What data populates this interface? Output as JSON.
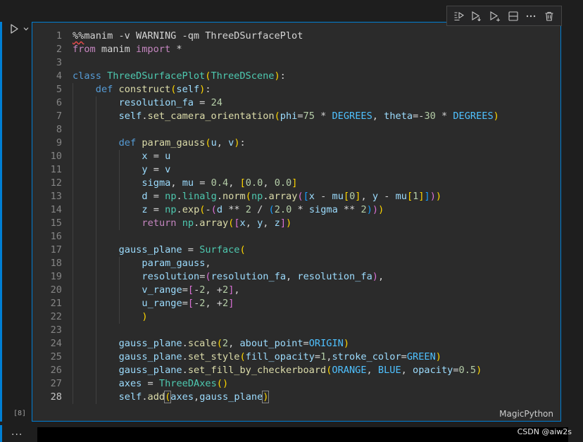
{
  "cell": {
    "execution_count": "[8]",
    "language": "MagicPython",
    "lines": [
      {
        "num": "1",
        "indent": 0,
        "tokens": [
          {
            "t": "%%",
            "c": "op mag"
          },
          {
            "t": "manim -v WARNING -qm ThreeDSurfacePlot",
            "c": "op"
          }
        ]
      },
      {
        "num": "2",
        "indent": 0,
        "tokens": [
          {
            "t": "from",
            "c": "kw2"
          },
          {
            "t": " manim ",
            "c": "op"
          },
          {
            "t": "import",
            "c": "kw2"
          },
          {
            "t": " *",
            "c": "op"
          }
        ]
      },
      {
        "num": "3",
        "indent": 0,
        "tokens": []
      },
      {
        "num": "4",
        "indent": 0,
        "tokens": [
          {
            "t": "class",
            "c": "kw"
          },
          {
            "t": " ",
            "c": "op"
          },
          {
            "t": "ThreeDSurfacePlot",
            "c": "cls"
          },
          {
            "t": "(",
            "c": "br1"
          },
          {
            "t": "ThreeDScene",
            "c": "cls"
          },
          {
            "t": ")",
            "c": "br1"
          },
          {
            "t": ":",
            "c": "op"
          }
        ]
      },
      {
        "num": "5",
        "indent": 1,
        "tokens": [
          {
            "t": "def",
            "c": "kw"
          },
          {
            "t": " ",
            "c": "op"
          },
          {
            "t": "construct",
            "c": "fn"
          },
          {
            "t": "(",
            "c": "br1"
          },
          {
            "t": "self",
            "c": "prm"
          },
          {
            "t": ")",
            "c": "br1"
          },
          {
            "t": ":",
            "c": "op"
          }
        ]
      },
      {
        "num": "6",
        "indent": 2,
        "tokens": [
          {
            "t": "resolution_fa",
            "c": "prm"
          },
          {
            "t": " = ",
            "c": "op"
          },
          {
            "t": "24",
            "c": "num"
          }
        ]
      },
      {
        "num": "7",
        "indent": 2,
        "tokens": [
          {
            "t": "self",
            "c": "prm"
          },
          {
            "t": ".",
            "c": "op"
          },
          {
            "t": "set_camera_orientation",
            "c": "fn"
          },
          {
            "t": "(",
            "c": "br1"
          },
          {
            "t": "phi",
            "c": "prm"
          },
          {
            "t": "=",
            "c": "op"
          },
          {
            "t": "75",
            "c": "num"
          },
          {
            "t": " * ",
            "c": "op"
          },
          {
            "t": "DEGREES",
            "c": "con"
          },
          {
            "t": ", ",
            "c": "op"
          },
          {
            "t": "theta",
            "c": "prm"
          },
          {
            "t": "=-",
            "c": "op"
          },
          {
            "t": "30",
            "c": "num"
          },
          {
            "t": " * ",
            "c": "op"
          },
          {
            "t": "DEGREES",
            "c": "con"
          },
          {
            "t": ")",
            "c": "br1"
          }
        ]
      },
      {
        "num": "8",
        "indent": 2,
        "tokens": []
      },
      {
        "num": "9",
        "indent": 2,
        "tokens": [
          {
            "t": "def",
            "c": "kw"
          },
          {
            "t": " ",
            "c": "op"
          },
          {
            "t": "param_gauss",
            "c": "fn"
          },
          {
            "t": "(",
            "c": "br1"
          },
          {
            "t": "u",
            "c": "prm"
          },
          {
            "t": ", ",
            "c": "op"
          },
          {
            "t": "v",
            "c": "prm"
          },
          {
            "t": ")",
            "c": "br1"
          },
          {
            "t": ":",
            "c": "op"
          }
        ]
      },
      {
        "num": "10",
        "indent": 3,
        "tokens": [
          {
            "t": "x",
            "c": "prm"
          },
          {
            "t": " = ",
            "c": "op"
          },
          {
            "t": "u",
            "c": "prm"
          }
        ]
      },
      {
        "num": "11",
        "indent": 3,
        "tokens": [
          {
            "t": "y",
            "c": "prm"
          },
          {
            "t": " = ",
            "c": "op"
          },
          {
            "t": "v",
            "c": "prm"
          }
        ]
      },
      {
        "num": "12",
        "indent": 3,
        "tokens": [
          {
            "t": "sigma",
            "c": "prm"
          },
          {
            "t": ", ",
            "c": "op"
          },
          {
            "t": "mu",
            "c": "prm"
          },
          {
            "t": " = ",
            "c": "op"
          },
          {
            "t": "0.4",
            "c": "num"
          },
          {
            "t": ", ",
            "c": "op"
          },
          {
            "t": "[",
            "c": "br1"
          },
          {
            "t": "0.0",
            "c": "num"
          },
          {
            "t": ", ",
            "c": "op"
          },
          {
            "t": "0.0",
            "c": "num"
          },
          {
            "t": "]",
            "c": "br1"
          }
        ]
      },
      {
        "num": "13",
        "indent": 3,
        "tokens": [
          {
            "t": "d",
            "c": "prm"
          },
          {
            "t": " = ",
            "c": "op"
          },
          {
            "t": "np",
            "c": "cls"
          },
          {
            "t": ".",
            "c": "op"
          },
          {
            "t": "linalg",
            "c": "cls"
          },
          {
            "t": ".",
            "c": "op"
          },
          {
            "t": "norm",
            "c": "fn"
          },
          {
            "t": "(",
            "c": "br1"
          },
          {
            "t": "np",
            "c": "cls"
          },
          {
            "t": ".",
            "c": "op"
          },
          {
            "t": "array",
            "c": "fn"
          },
          {
            "t": "(",
            "c": "br2"
          },
          {
            "t": "[",
            "c": "br3"
          },
          {
            "t": "x",
            "c": "prm"
          },
          {
            "t": " - ",
            "c": "op"
          },
          {
            "t": "mu",
            "c": "prm"
          },
          {
            "t": "[",
            "c": "br1"
          },
          {
            "t": "0",
            "c": "num"
          },
          {
            "t": "]",
            "c": "br1"
          },
          {
            "t": ", ",
            "c": "op"
          },
          {
            "t": "y",
            "c": "prm"
          },
          {
            "t": " - ",
            "c": "op"
          },
          {
            "t": "mu",
            "c": "prm"
          },
          {
            "t": "[",
            "c": "br1"
          },
          {
            "t": "1",
            "c": "num"
          },
          {
            "t": "]",
            "c": "br1"
          },
          {
            "t": "]",
            "c": "br3"
          },
          {
            "t": ")",
            "c": "br2"
          },
          {
            "t": ")",
            "c": "br1"
          }
        ]
      },
      {
        "num": "14",
        "indent": 3,
        "tokens": [
          {
            "t": "z",
            "c": "prm"
          },
          {
            "t": " = ",
            "c": "op"
          },
          {
            "t": "np",
            "c": "cls"
          },
          {
            "t": ".",
            "c": "op"
          },
          {
            "t": "exp",
            "c": "fn"
          },
          {
            "t": "(",
            "c": "br1"
          },
          {
            "t": "-",
            "c": "op"
          },
          {
            "t": "(",
            "c": "br2"
          },
          {
            "t": "d",
            "c": "prm"
          },
          {
            "t": " ** ",
            "c": "op"
          },
          {
            "t": "2",
            "c": "num"
          },
          {
            "t": " / ",
            "c": "op"
          },
          {
            "t": "(",
            "c": "br3"
          },
          {
            "t": "2.0",
            "c": "num"
          },
          {
            "t": " * ",
            "c": "op"
          },
          {
            "t": "sigma",
            "c": "prm"
          },
          {
            "t": " ** ",
            "c": "op"
          },
          {
            "t": "2",
            "c": "num"
          },
          {
            "t": ")",
            "c": "br3"
          },
          {
            "t": ")",
            "c": "br2"
          },
          {
            "t": ")",
            "c": "br1"
          }
        ]
      },
      {
        "num": "15",
        "indent": 3,
        "tokens": [
          {
            "t": "return",
            "c": "kw2"
          },
          {
            "t": " ",
            "c": "op"
          },
          {
            "t": "np",
            "c": "cls"
          },
          {
            "t": ".",
            "c": "op"
          },
          {
            "t": "array",
            "c": "fn"
          },
          {
            "t": "(",
            "c": "br1"
          },
          {
            "t": "[",
            "c": "br2"
          },
          {
            "t": "x",
            "c": "prm"
          },
          {
            "t": ", ",
            "c": "op"
          },
          {
            "t": "y",
            "c": "prm"
          },
          {
            "t": ", ",
            "c": "op"
          },
          {
            "t": "z",
            "c": "prm"
          },
          {
            "t": "]",
            "c": "br2"
          },
          {
            "t": ")",
            "c": "br1"
          }
        ]
      },
      {
        "num": "16",
        "indent": 2,
        "tokens": []
      },
      {
        "num": "17",
        "indent": 2,
        "tokens": [
          {
            "t": "gauss_plane",
            "c": "prm"
          },
          {
            "t": " = ",
            "c": "op"
          },
          {
            "t": "Surface",
            "c": "cls"
          },
          {
            "t": "(",
            "c": "br1"
          }
        ]
      },
      {
        "num": "18",
        "indent": 3,
        "tokens": [
          {
            "t": "param_gauss",
            "c": "prm"
          },
          {
            "t": ",",
            "c": "op"
          }
        ]
      },
      {
        "num": "19",
        "indent": 3,
        "tokens": [
          {
            "t": "resolution",
            "c": "prm"
          },
          {
            "t": "=",
            "c": "op"
          },
          {
            "t": "(",
            "c": "br2"
          },
          {
            "t": "resolution_fa",
            "c": "prm"
          },
          {
            "t": ", ",
            "c": "op"
          },
          {
            "t": "resolution_fa",
            "c": "prm"
          },
          {
            "t": ")",
            "c": "br2"
          },
          {
            "t": ",",
            "c": "op"
          }
        ]
      },
      {
        "num": "20",
        "indent": 3,
        "tokens": [
          {
            "t": "v_range",
            "c": "prm"
          },
          {
            "t": "=",
            "c": "op"
          },
          {
            "t": "[",
            "c": "br2"
          },
          {
            "t": "-",
            "c": "op"
          },
          {
            "t": "2",
            "c": "num"
          },
          {
            "t": ", +",
            "c": "op"
          },
          {
            "t": "2",
            "c": "num"
          },
          {
            "t": "]",
            "c": "br2"
          },
          {
            "t": ",",
            "c": "op"
          }
        ]
      },
      {
        "num": "21",
        "indent": 3,
        "tokens": [
          {
            "t": "u_range",
            "c": "prm"
          },
          {
            "t": "=",
            "c": "op"
          },
          {
            "t": "[",
            "c": "br2"
          },
          {
            "t": "-",
            "c": "op"
          },
          {
            "t": "2",
            "c": "num"
          },
          {
            "t": ", +",
            "c": "op"
          },
          {
            "t": "2",
            "c": "num"
          },
          {
            "t": "]",
            "c": "br2"
          }
        ]
      },
      {
        "num": "22",
        "indent": 3,
        "tokens": [
          {
            "t": ")",
            "c": "br1"
          }
        ]
      },
      {
        "num": "23",
        "indent": 2,
        "tokens": []
      },
      {
        "num": "24",
        "indent": 2,
        "tokens": [
          {
            "t": "gauss_plane",
            "c": "prm"
          },
          {
            "t": ".",
            "c": "op"
          },
          {
            "t": "scale",
            "c": "fn"
          },
          {
            "t": "(",
            "c": "br1"
          },
          {
            "t": "2",
            "c": "num"
          },
          {
            "t": ", ",
            "c": "op"
          },
          {
            "t": "about_point",
            "c": "prm"
          },
          {
            "t": "=",
            "c": "op"
          },
          {
            "t": "ORIGIN",
            "c": "con"
          },
          {
            "t": ")",
            "c": "br1"
          }
        ]
      },
      {
        "num": "25",
        "indent": 2,
        "tokens": [
          {
            "t": "gauss_plane",
            "c": "prm"
          },
          {
            "t": ".",
            "c": "op"
          },
          {
            "t": "set_style",
            "c": "fn"
          },
          {
            "t": "(",
            "c": "br1"
          },
          {
            "t": "fill_opacity",
            "c": "prm"
          },
          {
            "t": "=",
            "c": "op"
          },
          {
            "t": "1",
            "c": "num"
          },
          {
            "t": ",",
            "c": "op"
          },
          {
            "t": "stroke_color",
            "c": "prm"
          },
          {
            "t": "=",
            "c": "op"
          },
          {
            "t": "GREEN",
            "c": "con"
          },
          {
            "t": ")",
            "c": "br1"
          }
        ]
      },
      {
        "num": "26",
        "indent": 2,
        "tokens": [
          {
            "t": "gauss_plane",
            "c": "prm"
          },
          {
            "t": ".",
            "c": "op"
          },
          {
            "t": "set_fill_by_checkerboard",
            "c": "fn"
          },
          {
            "t": "(",
            "c": "br1"
          },
          {
            "t": "ORANGE",
            "c": "con"
          },
          {
            "t": ", ",
            "c": "op"
          },
          {
            "t": "BLUE",
            "c": "con"
          },
          {
            "t": ", ",
            "c": "op"
          },
          {
            "t": "opacity",
            "c": "prm"
          },
          {
            "t": "=",
            "c": "op"
          },
          {
            "t": "0.5",
            "c": "num"
          },
          {
            "t": ")",
            "c": "br1"
          }
        ]
      },
      {
        "num": "27",
        "indent": 2,
        "tokens": [
          {
            "t": "axes",
            "c": "prm"
          },
          {
            "t": " = ",
            "c": "op"
          },
          {
            "t": "ThreeDAxes",
            "c": "cls"
          },
          {
            "t": "(",
            "c": "br1"
          },
          {
            "t": ")",
            "c": "br1"
          }
        ]
      },
      {
        "num": "28",
        "indent": 2,
        "active": true,
        "tokens": [
          {
            "t": "self",
            "c": "prm"
          },
          {
            "t": ".",
            "c": "op"
          },
          {
            "t": "add",
            "c": "fn"
          },
          {
            "t": "(",
            "c": "br1 bracket-box"
          },
          {
            "t": "axes",
            "c": "prm"
          },
          {
            "t": ",",
            "c": "op"
          },
          {
            "t": "gauss_plane",
            "c": "prm"
          },
          {
            "t": ")",
            "c": "br1 bracket-box"
          }
        ]
      }
    ]
  },
  "watermark": "CSDN @aiw2s",
  "next_cell": {
    "ellipsis": "..."
  },
  "colors": {
    "accent": "#007fd4",
    "editor_bg": "#2b2b2b",
    "page_bg": "#1e1e1e"
  },
  "icons": {
    "run": "play-icon",
    "expand": "chevron-down-icon",
    "toolbar": [
      "execute-above-icon",
      "execute-cell-below-icon",
      "execute-below-icon",
      "split-cell-icon",
      "more-icon",
      "trash-icon"
    ]
  }
}
